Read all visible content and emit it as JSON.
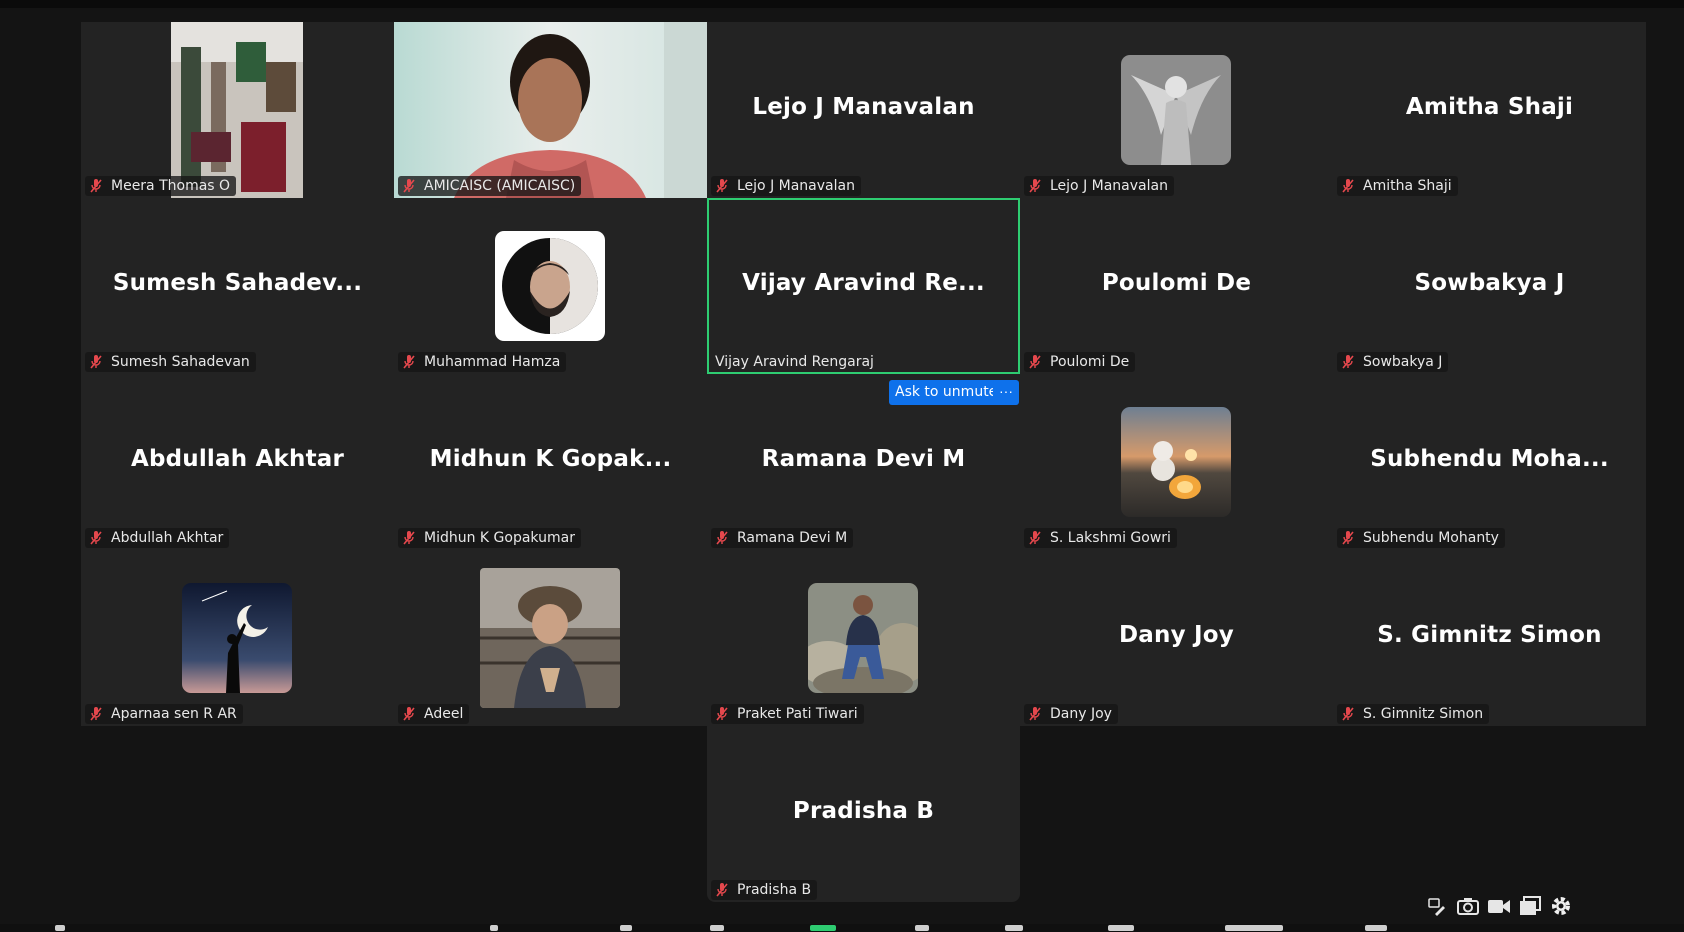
{
  "meeting": {
    "participants": [
      {
        "display": "",
        "tag": "Meera Thomas O",
        "muted": true
      },
      {
        "display": "",
        "tag": "AMICAISC (AMICAISC)",
        "muted": true
      },
      {
        "display": "Lejo J Manavalan",
        "tag": "Lejo J Manavalan",
        "muted": true
      },
      {
        "display": "",
        "tag": "Lejo J Manavalan",
        "muted": true
      },
      {
        "display": "Amitha Shaji",
        "tag": "Amitha Shaji",
        "muted": true
      },
      {
        "display": "Sumesh  Sahadev...",
        "tag": "Sumesh Sahadevan",
        "muted": true
      },
      {
        "display": "",
        "tag": "Muhammad Hamza",
        "muted": true
      },
      {
        "display": "Vijay  Aravind  Re...",
        "tag": "Vijay Aravind Rengaraj",
        "muted": false
      },
      {
        "display": "Poulomi De",
        "tag": "Poulomi De",
        "muted": true
      },
      {
        "display": "Sowbakya J",
        "tag": "Sowbakya J",
        "muted": true
      },
      {
        "display": "Abdullah Akhtar",
        "tag": "Abdullah Akhtar",
        "muted": true
      },
      {
        "display": "Midhun  K  Gopak...",
        "tag": "Midhun K Gopakumar",
        "muted": true
      },
      {
        "display": "Ramana Devi M",
        "tag": "Ramana Devi M",
        "muted": true
      },
      {
        "display": "",
        "tag": "S. Lakshmi Gowri",
        "muted": true
      },
      {
        "display": "Subhendu  Moha...",
        "tag": "Subhendu Mohanty",
        "muted": true
      },
      {
        "display": "",
        "tag": "Aparnaa sen R AR",
        "muted": true
      },
      {
        "display": "",
        "tag": "Adeel",
        "muted": true
      },
      {
        "display": "",
        "tag": "Praket Pati Tiwari",
        "muted": true
      },
      {
        "display": "Dany Joy",
        "tag": "Dany Joy",
        "muted": true
      },
      {
        "display": "S. Gimnitz Simon",
        "tag": "S. Gimnitz Simon",
        "muted": true
      },
      {
        "display": "Pradisha B",
        "tag": "Pradisha B",
        "muted": true
      }
    ],
    "ask_to_unmute_label": "Ask to unmute",
    "more_label": "···"
  },
  "colors": {
    "tile_bg": "#232323",
    "page_bg": "#141414",
    "active_speaker_border": "#2ecc71",
    "button_blue": "#0e71eb",
    "muted_mic": "#e5484d"
  },
  "icons": {
    "muted": "microphone-muted-icon",
    "toolbar": [
      "annotate-icon",
      "camera-icon",
      "video-icon",
      "share-screen-icon",
      "gear-icon"
    ]
  }
}
